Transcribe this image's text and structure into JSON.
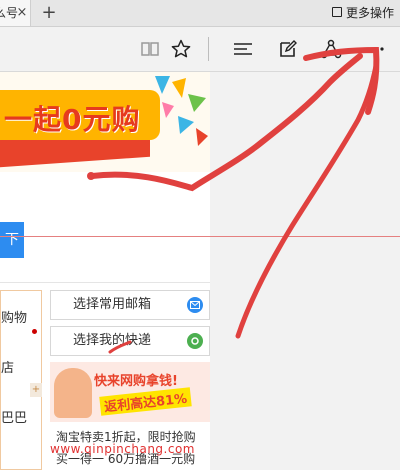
{
  "tabbar": {
    "tab_text": "么号",
    "tab_close": "×",
    "new_tab": "+",
    "more_actions_label": "更多操作"
  },
  "toolbar": {
    "icons": [
      "reading-view-icon",
      "favorite-star-icon",
      "hub-icon",
      "web-note-icon",
      "share-icon",
      "more-actions-icon"
    ]
  },
  "page": {
    "banner_text": "一起0元购",
    "button_label": "下",
    "left_items": [
      "购物",
      "店",
      "巴巴"
    ],
    "expander": "+",
    "list": [
      {
        "label": "选择常用邮箱",
        "icon": "mail-icon",
        "color": "#2d8cf0"
      },
      {
        "label": "选择我的快递",
        "icon": "delivery-icon",
        "color": "#4caf50"
      }
    ],
    "ad": {
      "title": "快来网购拿钱!",
      "subtitle": "返利高达81%"
    },
    "deals": [
      "淘宝特卖1折起，限时抢购",
      "买一得一 60万撸酒一元购"
    ],
    "watermark": "www.qinpinchang.com"
  },
  "colors": {
    "annotation": "#e0413f",
    "accent": "#2d8cf0"
  }
}
